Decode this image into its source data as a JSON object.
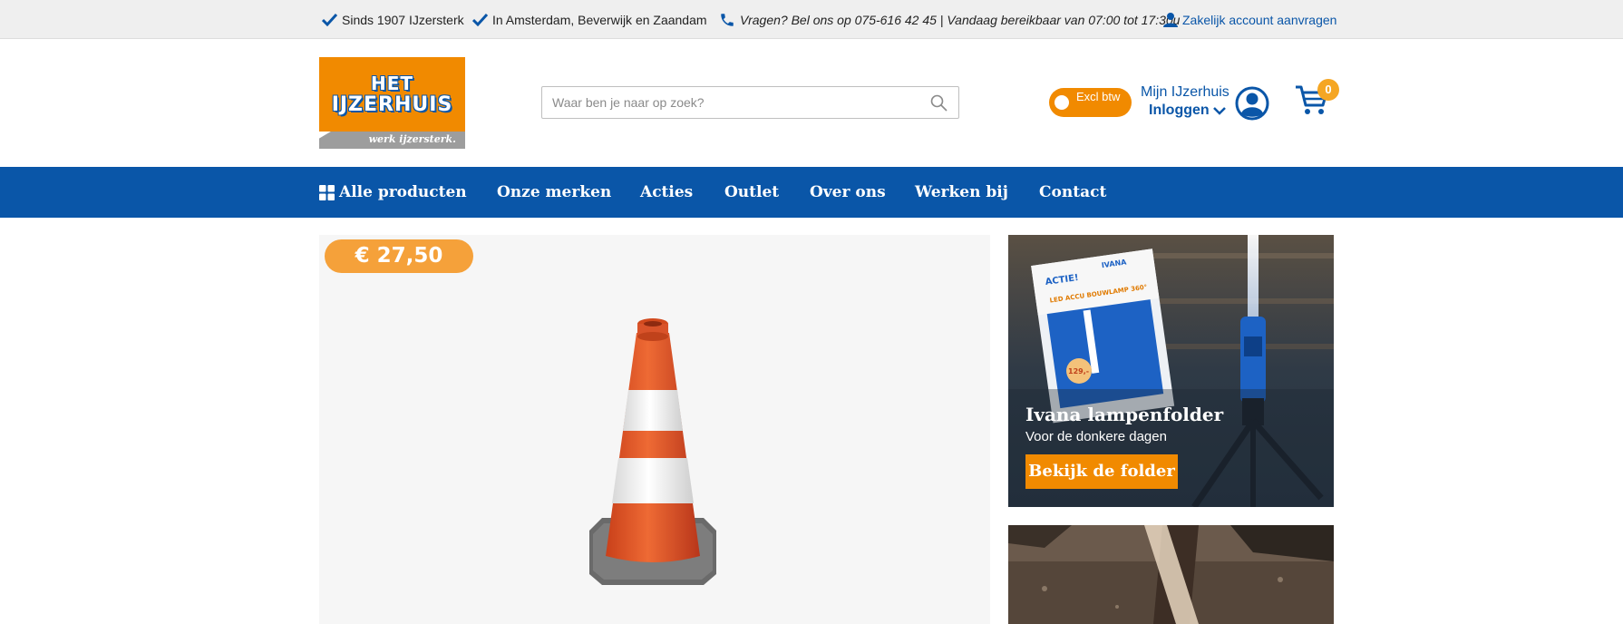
{
  "topbar": {
    "usp1": "Sinds 1907 IJzersterk",
    "usp2": "In Amsterdam, Beverwijk en Zaandam",
    "phone": "Vragen? Bel ons op 075-616 42 45 | Vandaag bereikbaar van 07:00 tot 17:30u",
    "business_link": "Zakelijk account aanvragen"
  },
  "header": {
    "logo_line1": "HET",
    "logo_line2": "IJZERHUIS",
    "logo_tagline": "werk ijzersterk.",
    "search_placeholder": "Waar ben je naar op zoek?",
    "vat_toggle": "Excl btw",
    "account_title": "Mijn IJzerhuis",
    "login_label": "Inloggen",
    "cart_count": "0"
  },
  "nav": {
    "items": [
      "Alle producten",
      "Onze merken",
      "Acties",
      "Outlet",
      "Over ons",
      "Werken bij",
      "Contact"
    ]
  },
  "product": {
    "price": "€ 27,50"
  },
  "promo": {
    "title": "Ivana lampenfolder",
    "subtitle": "Voor de donkere dagen",
    "button": "Bekijk de folder",
    "folder_badge": "ACTIE!",
    "folder_brand": "IVANA",
    "folder_heading": "LED ACCU BOUWLAMP 360°",
    "folder_price": "129,-"
  },
  "colors": {
    "brand_blue": "#0a56a8",
    "brand_orange": "#f18a00",
    "price_orange": "#f5a13a"
  },
  "icons": {
    "usp": "check-icon",
    "phone": "phone-icon",
    "business": "person-icon",
    "search": "search-icon",
    "user": "user-circle-icon",
    "cart": "cart-icon",
    "grid": "grid-icon",
    "chevron": "chevron-down-icon"
  }
}
